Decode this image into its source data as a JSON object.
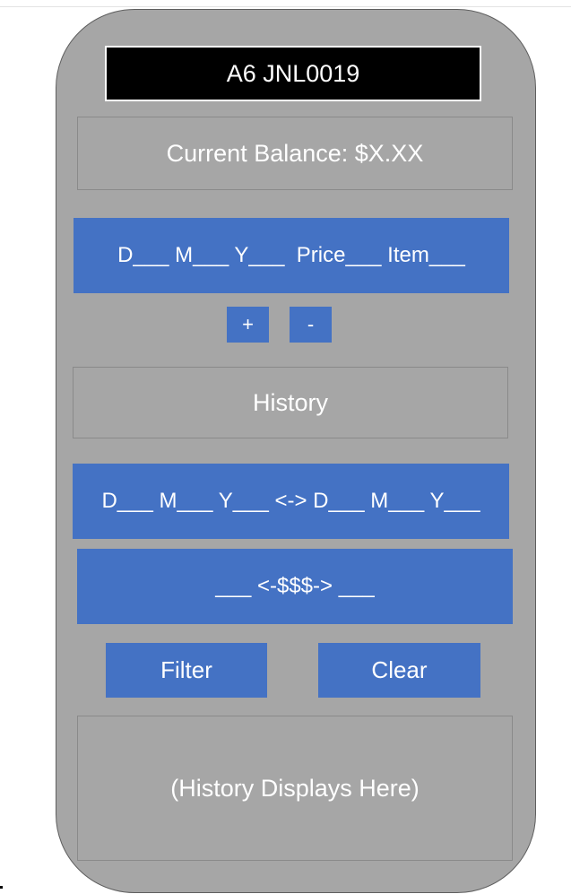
{
  "header": {
    "title": "A6 JNL0019"
  },
  "balance": {
    "label": "Current Balance: $X.XX"
  },
  "entry": {
    "fields": "D___ M___ Y___  Price___ Item___"
  },
  "entry_actions": {
    "add_label": "+",
    "remove_label": "-"
  },
  "history": {
    "heading": "History"
  },
  "filters": {
    "date_range": "D___ M___ Y___ <-> D___ M___ Y___",
    "price_range": "___ <-$$$-> ___",
    "filter_label": "Filter",
    "clear_label": "Clear"
  },
  "history_display": {
    "placeholder": "(History Displays Here)"
  },
  "colors": {
    "accent": "#4472c4",
    "panel": "#a6a6a6",
    "title_bg": "#000000"
  }
}
